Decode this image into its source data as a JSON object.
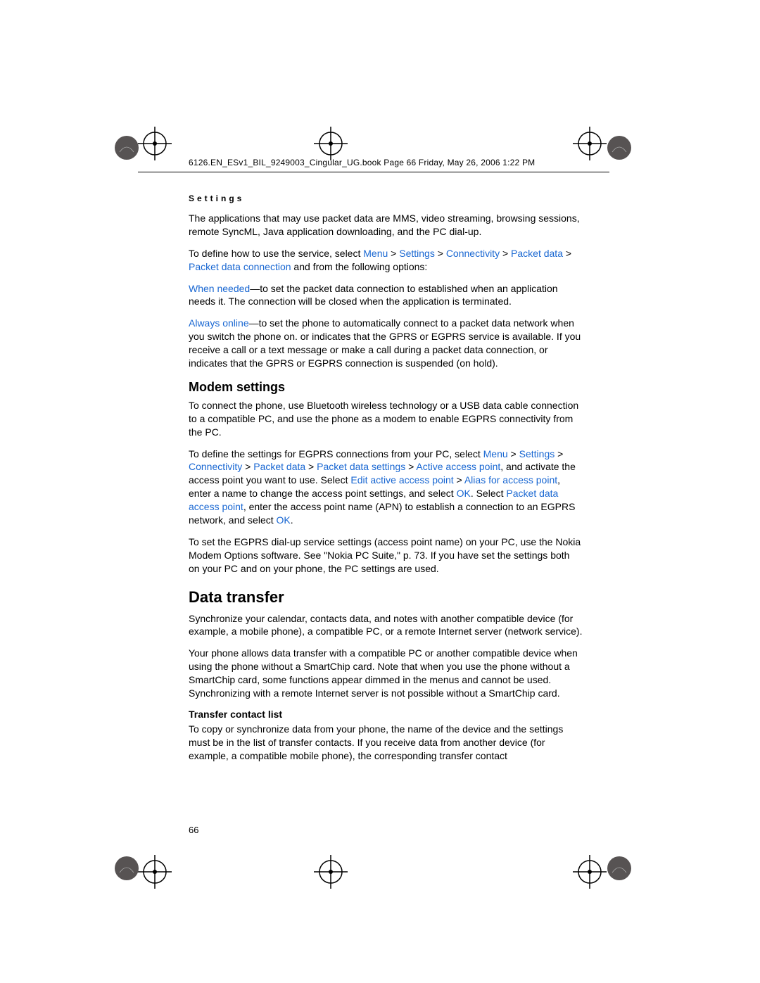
{
  "header": "6126.EN_ESv1_BIL_9249003_Cingular_UG.book  Page 66  Friday, May 26, 2006  1:22 PM",
  "section_label": "Settings",
  "para1": "The applications that may use packet data are MMS, video streaming, browsing sessions, remote SyncML, Java application downloading, and the PC dial-up.",
  "para2_pre": "To define how to use the service, select ",
  "para2_menu": "Menu",
  "para2_gt1": " > ",
  "para2_settings": "Settings",
  "para2_gt2": " > ",
  "para2_conn": "Connectivity",
  "para2_gt3": " > ",
  "para2_pd": "Packet data",
  "para2_gt4": " > ",
  "para2_pdc": "Packet data connection",
  "para2_post": " and from the following options:",
  "para3_wn": "When needed",
  "para3_txt": "—to set the packet data connection to established when an application needs it. The connection will be closed when the application is terminated.",
  "para4_ao": "Always online",
  "para4_txt1": "—to set the phone to automatically connect to a packet data network when you switch the phone on.        or        indicates that the GPRS or EGPRS service is available. If you receive a call or a text message or make a call during a packet data connection,        or        indicates that the GPRS or EGPRS connection is suspended (on hold).",
  "modem_heading": "Modem settings",
  "modem_para1": "To connect the phone, use Bluetooth wireless technology or a USB data cable connection to a compatible PC, and use the phone as a modem to enable EGPRS connectivity from the PC.",
  "modem_para2_pre": "To define the settings for EGPRS connections from your PC, select ",
  "modem_menu": "Menu",
  "modem_gt1": " > ",
  "modem_settings": "Settings",
  "modem_gt2": " > ",
  "modem_conn": "Connectivity",
  "modem_gt3": " > ",
  "modem_pd": "Packet data",
  "modem_gt4": " > ",
  "modem_pds": "Packet data settings",
  "modem_gt5": " > ",
  "modem_aap": "Active access point",
  "modem_mid1": ", and activate the access point you want to use. Select ",
  "modem_eaap": "Edit active access point",
  "modem_gt6": " > ",
  "modem_afap": "Alias for access point",
  "modem_mid2": ", enter a name to change the access point settings, and select ",
  "modem_ok1": "OK",
  "modem_mid3": ". Select ",
  "modem_pdap": "Packet data access point",
  "modem_mid4": ", enter the access point name (APN) to establish a connection to an EGPRS network, and select ",
  "modem_ok2": "OK",
  "modem_end": ".",
  "modem_para3": "To set the EGPRS dial-up service settings (access point name) on your PC, use the Nokia Modem Options software. See \"Nokia PC Suite,\" p. 73. If you have set the settings both on your PC and on your phone, the PC settings are used.",
  "dt_heading": "Data transfer",
  "dt_para1": "Synchronize your calendar, contacts data, and notes with another compatible device (for example, a mobile phone), a compatible PC, or a remote Internet server (network service).",
  "dt_para2": "Your phone allows data transfer with a compatible PC or another compatible device when using the phone without a SmartChip card. Note that when you use the phone without a SmartChip card, some functions appear dimmed in the menus and cannot be used. Synchronizing with a remote Internet server is not possible without a SmartChip card.",
  "tcl_heading": "Transfer contact list",
  "tcl_para": "To copy or synchronize data from your phone, the name of the device and the settings must be in the list of transfer contacts. If you receive data from another device (for example, a compatible mobile phone), the corresponding transfer contact",
  "page_number": "66"
}
